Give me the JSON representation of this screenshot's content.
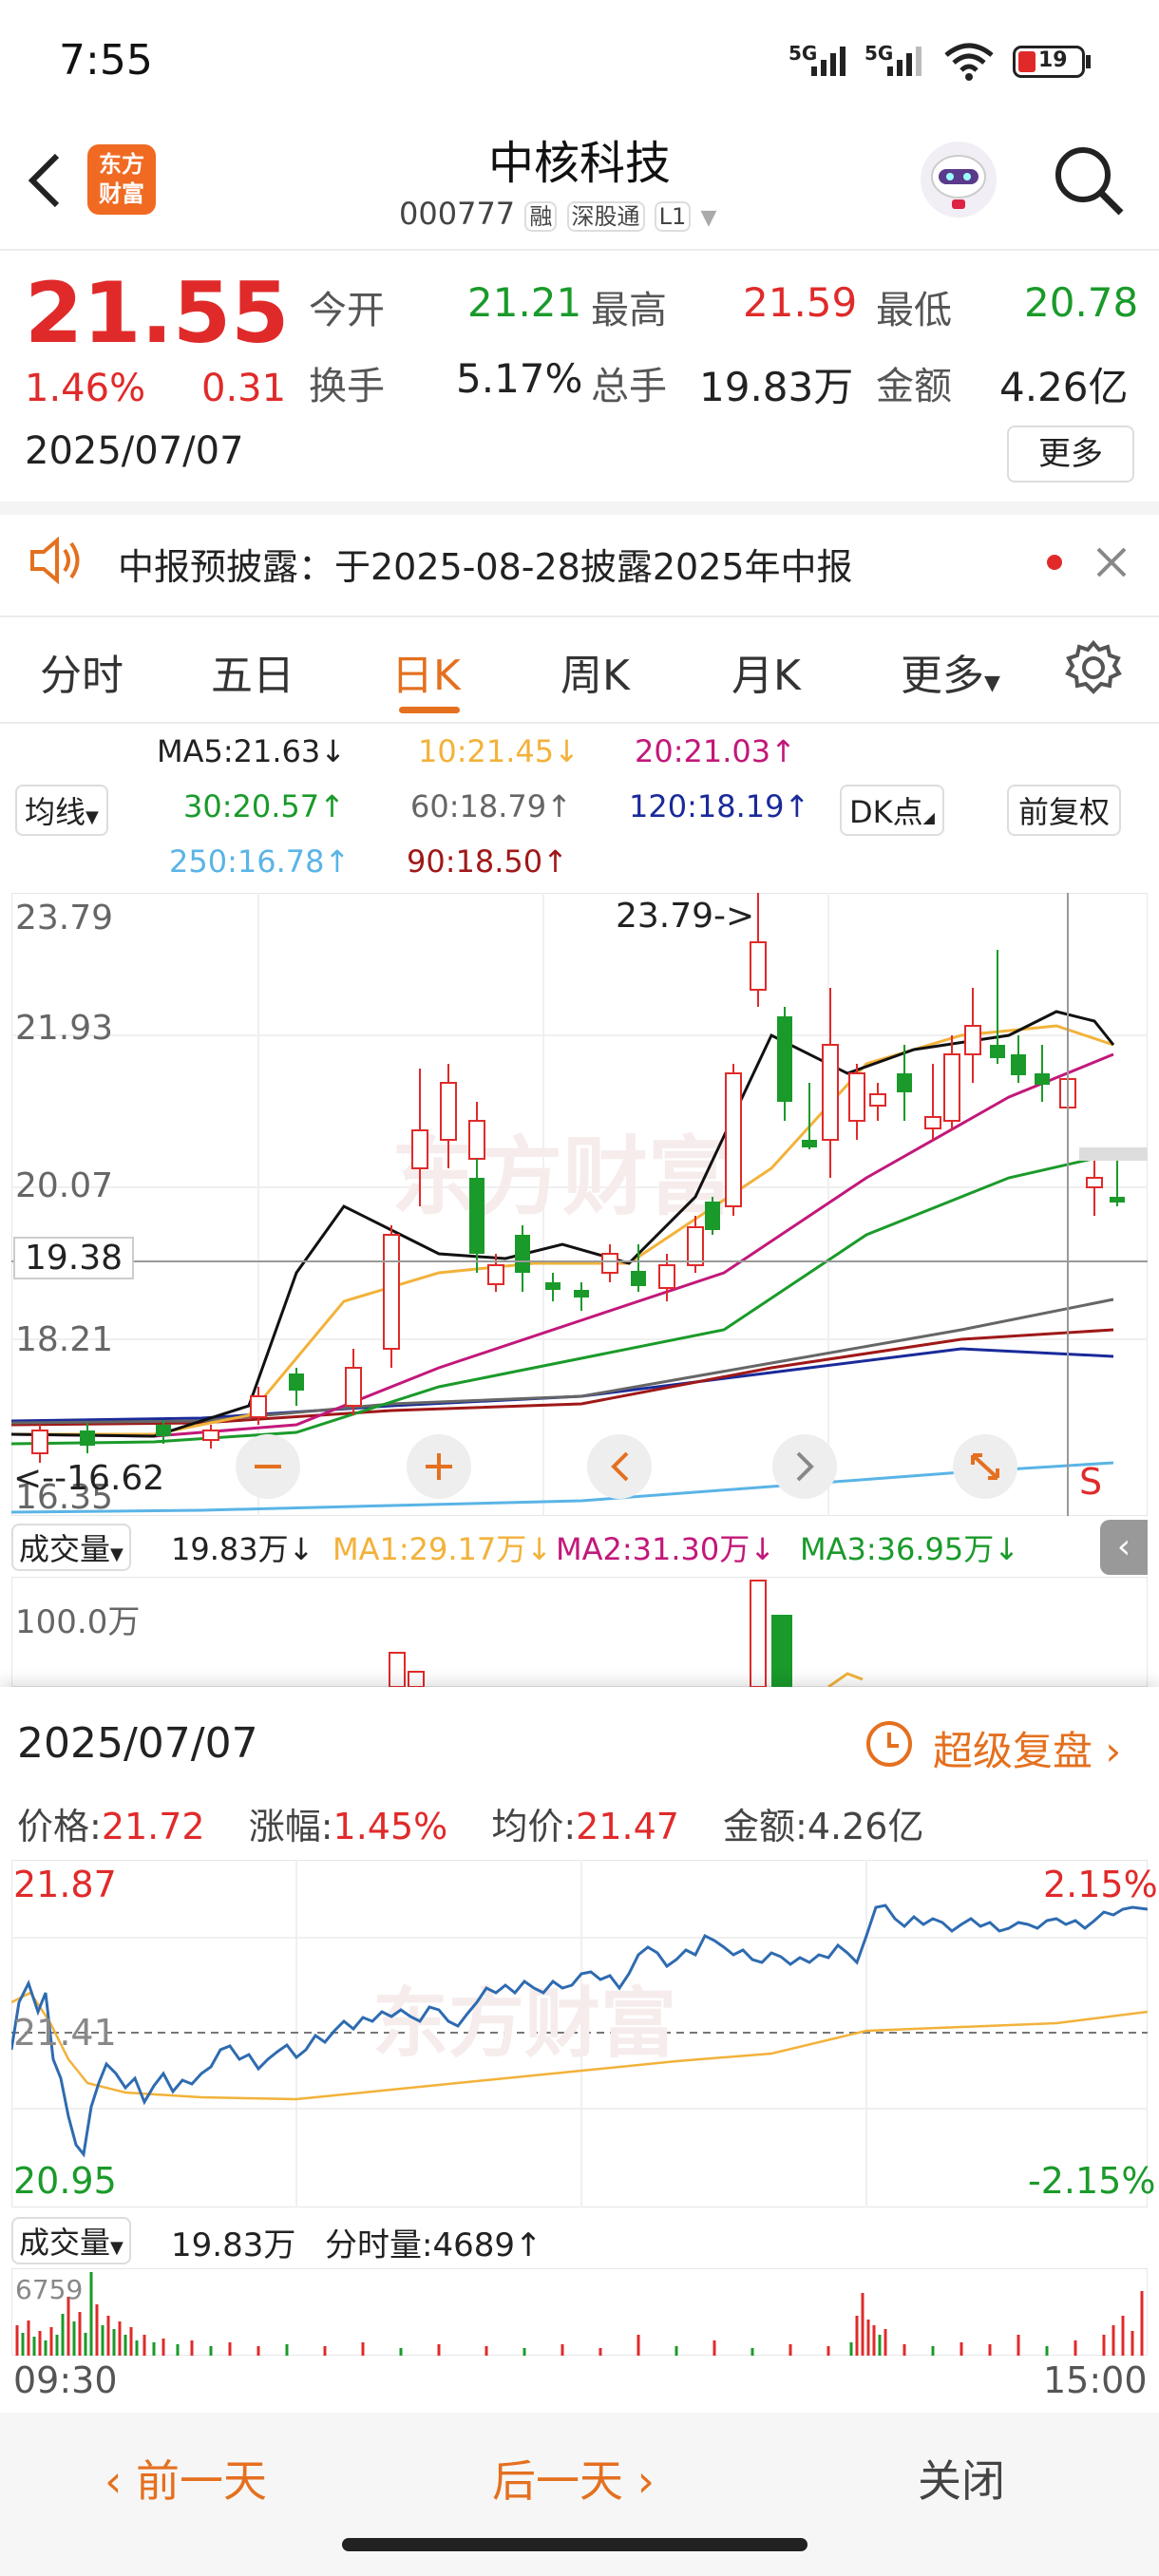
{
  "status_bar": {
    "time": "7:55",
    "signal1": "5G",
    "signal2": "5G",
    "battery": "19"
  },
  "header": {
    "brand_line1": "东方",
    "brand_line2": "财富",
    "title": "中核科技",
    "code": "000777",
    "tag_rong": "融",
    "tag_sgt": "深股通",
    "tag_level": "L1"
  },
  "quote": {
    "price": "21.55",
    "change_pct": "1.46%",
    "change": "0.31",
    "date": "2025/07/07",
    "open_label": "今开",
    "open": "21.21",
    "high_label": "最高",
    "high": "21.59",
    "low_label": "最低",
    "low": "20.78",
    "turnover_label": "换手",
    "turnover": "5.17%",
    "volume_label": "总手",
    "volume": "19.83万",
    "amount_label": "金额",
    "amount": "4.26亿",
    "more": "更多"
  },
  "notice": {
    "text": "中报预披露：于2025-08-28披露2025年中报"
  },
  "tabs": [
    "分时",
    "五日",
    "日K",
    "周K",
    "月K",
    "更多"
  ],
  "ma": {
    "ma5": "MA5:21.63↓",
    "ma10": "10:21.45↓",
    "ma20": "20:21.03↑",
    "ma30": "30:20.57↑",
    "ma60": "60:18.79↑",
    "ma120": "120:18.19↑",
    "ma250": "250:16.78↑",
    "ma90": "90:18.50↑",
    "selector": "均线",
    "dk": "DK点",
    "fq": "前复权"
  },
  "kline": {
    "y1": "23.79",
    "y2": "21.93",
    "y3": "20.07",
    "y4": "18.21",
    "y5": "16.35",
    "cross": "19.38",
    "max_marker": "23.79->",
    "min_marker": "<--16.62",
    "s_marker": "S"
  },
  "volume": {
    "selector": "成交量",
    "value": "19.83万↓",
    "ma1": "MA1:29.17万↓",
    "ma2": "MA2:31.30万↓",
    "ma3": "MA3:36.95万↓",
    "top": "100.0万"
  },
  "popup": {
    "date": "2025/07/07",
    "replay": "超级复盘",
    "price_label": "价格:",
    "price": "21.72",
    "chg_label": "涨幅:",
    "chg": "1.45%",
    "avg_label": "均价:",
    "avg": "21.47",
    "amt_label": "金额:",
    "amt": "4.26亿",
    "hi": "21.87",
    "mid": "21.41",
    "lo": "20.95",
    "hi_pct": "2.15%",
    "lo_pct": "-2.15%",
    "vol_selector": "成交量",
    "vol_total": "19.83万",
    "vol_min": "分时量:4689↑",
    "vol_top": "6759",
    "t_start": "09:30",
    "t_end": "15:00",
    "prev_day": "前一天",
    "next_day": "后一天",
    "close": "关闭"
  }
}
